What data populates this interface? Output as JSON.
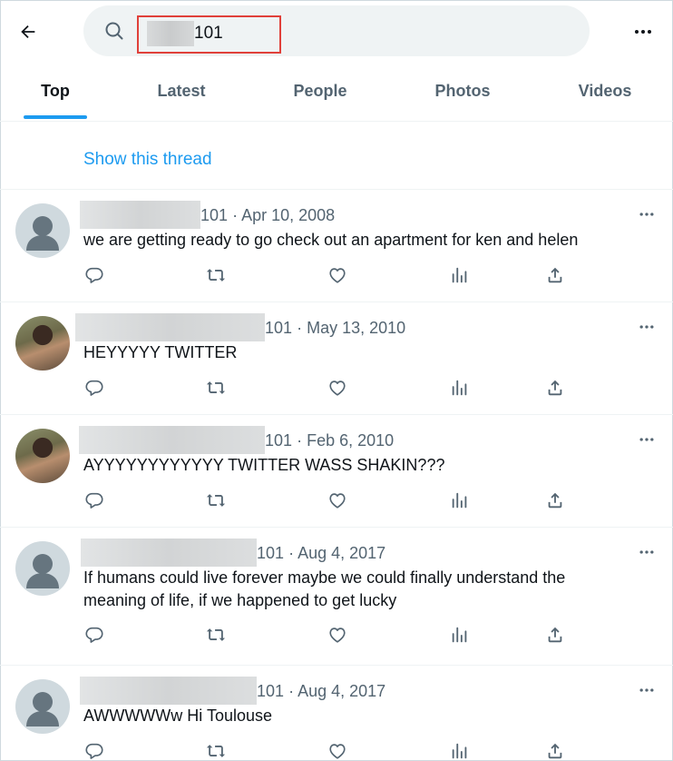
{
  "search": {
    "value": "101"
  },
  "tabs": [
    {
      "label": "Top",
      "active": true
    },
    {
      "label": "Latest",
      "active": false
    },
    {
      "label": "People",
      "active": false
    },
    {
      "label": "Photos",
      "active": false
    },
    {
      "label": "Videos",
      "active": false
    }
  ],
  "thread_link": "Show this thread",
  "tweets": [
    {
      "handle_suffix": "101",
      "separator": "·",
      "date": "Apr 10, 2008",
      "text": "we are getting ready to go check out an apartment for ken and helen",
      "avatar": "default"
    },
    {
      "handle_suffix": "101",
      "separator": "·",
      "date": "May 13, 2010",
      "text": "HEYYYYY TWITTER",
      "avatar": "photo"
    },
    {
      "handle_suffix": "101",
      "separator": "·",
      "date": "Feb 6, 2010",
      "text": "AYYYYYYYYYYYY TWITTER WASS SHAKIN???",
      "avatar": "photo"
    },
    {
      "handle_suffix": "101",
      "separator": "·",
      "date": "Aug 4, 2017",
      "text": "If humans could live forever maybe we could finally understand the meaning of life, if we happened to get lucky",
      "avatar": "default"
    },
    {
      "handle_suffix": "101",
      "separator": "·",
      "date": "Aug 4, 2017",
      "text": "AWWWWWw Hi Toulouse",
      "avatar": "default"
    }
  ],
  "colors": {
    "accent": "#1d9bf0",
    "highlight_box": "#e0403a",
    "muted_text": "#536471"
  }
}
